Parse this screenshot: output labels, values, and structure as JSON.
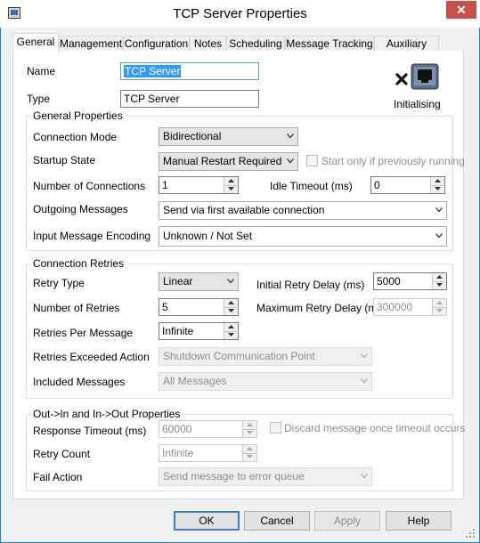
{
  "window": {
    "title": "TCP Server Properties"
  },
  "tabs": [
    "General",
    "Management",
    "Configuration",
    "Notes",
    "Scheduling",
    "Message Tracking",
    "Auxiliary Files"
  ],
  "status": {
    "text": "Initialising",
    "icon": "network-port-error-icon"
  },
  "name": {
    "label": "Name",
    "value": "TCP Server"
  },
  "type": {
    "label": "Type",
    "value": "TCP Server"
  },
  "general": {
    "legend": "General Properties",
    "connection_mode": {
      "label": "Connection Mode",
      "value": "Bidirectional"
    },
    "startup_state": {
      "label": "Startup State",
      "value": "Manual Restart Required"
    },
    "start_only": {
      "label": "Start only if previously running",
      "checked": false
    },
    "num_connections": {
      "label": "Number of Connections",
      "value": "1"
    },
    "idle_timeout": {
      "label": "Idle Timeout (ms)",
      "value": "0"
    },
    "outgoing": {
      "label": "Outgoing Messages",
      "value": "Send via first available connection"
    },
    "encoding": {
      "label": "Input Message Encoding",
      "value": "Unknown / Not Set"
    }
  },
  "retries": {
    "legend": "Connection Retries",
    "retry_type": {
      "label": "Retry Type",
      "value": "Linear"
    },
    "initial_delay": {
      "label": "Initial Retry Delay (ms)",
      "value": "5000"
    },
    "num_retries": {
      "label": "Number of Retries",
      "value": "5"
    },
    "max_delay": {
      "label": "Maximum Retry Delay (ms)",
      "value": "300000"
    },
    "per_message": {
      "label": "Retries Per Message",
      "value": "Infinite"
    },
    "exceeded_action": {
      "label": "Retries Exceeded Action",
      "value": "Shutdown Communication Point"
    },
    "included": {
      "label": "Included Messages",
      "value": "All Messages"
    }
  },
  "outin": {
    "legend": "Out->In and In->Out Properties",
    "response_timeout": {
      "label": "Response Timeout (ms)",
      "value": "60000"
    },
    "discard": {
      "label": "Discard message once timeout occurs",
      "checked": false
    },
    "retry_count": {
      "label": "Retry Count",
      "value": "Infinite"
    },
    "fail_action": {
      "label": "Fail Action",
      "value": "Send message to error queue"
    }
  },
  "buttons": {
    "ok": "OK",
    "cancel": "Cancel",
    "apply": "Apply",
    "help": "Help"
  }
}
